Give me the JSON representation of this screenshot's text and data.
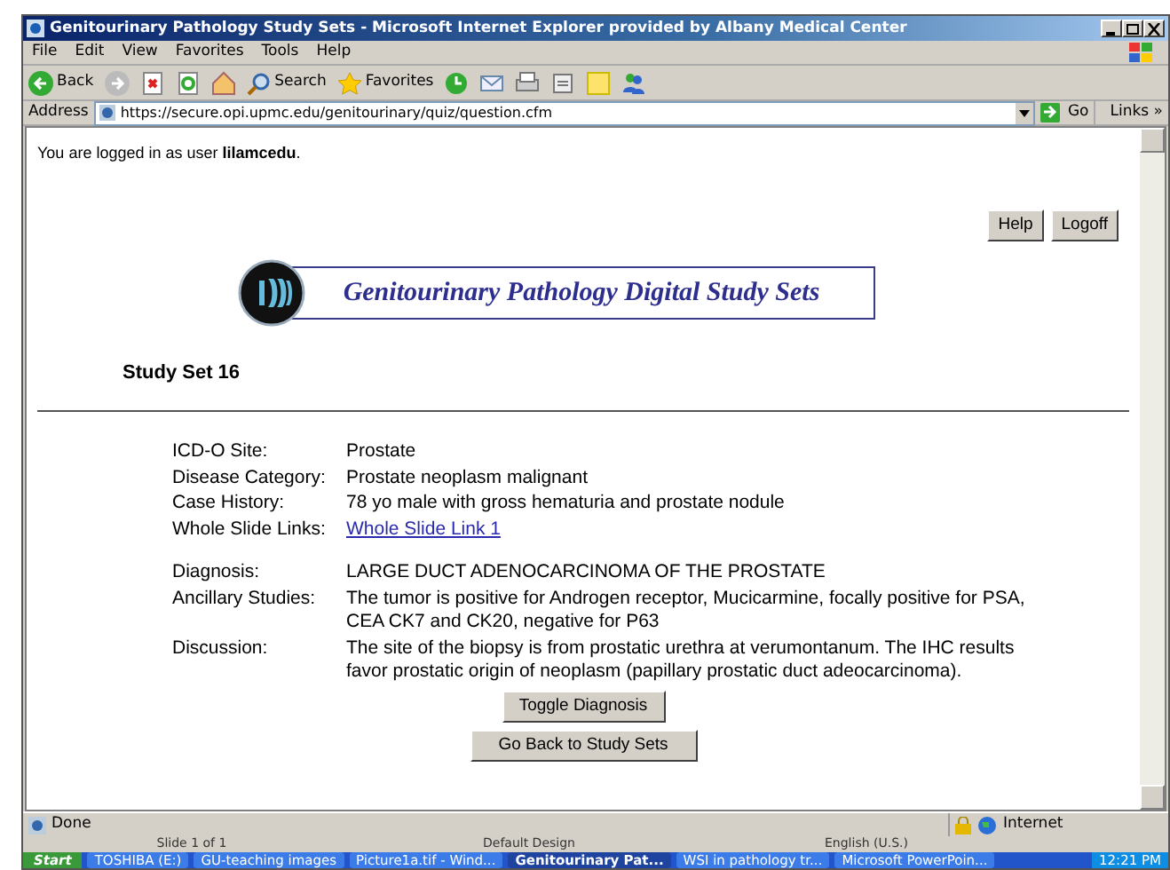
{
  "window": {
    "title": "Genitourinary Pathology Study Sets - Microsoft Internet Explorer provided by Albany Medical Center"
  },
  "menu": [
    "File",
    "Edit",
    "View",
    "Favorites",
    "Tools",
    "Help"
  ],
  "toolbar": [
    {
      "kind": "back",
      "label": "Back"
    },
    {
      "kind": "forward"
    },
    {
      "kind": "stop"
    },
    {
      "kind": "refresh"
    },
    {
      "kind": "home"
    },
    {
      "kind": "search",
      "label": "Search"
    },
    {
      "kind": "favorites",
      "label": "Favorites"
    },
    {
      "kind": "history"
    },
    {
      "kind": "mail"
    },
    {
      "kind": "print"
    },
    {
      "kind": "edit"
    },
    {
      "kind": "note"
    },
    {
      "kind": "messenger"
    }
  ],
  "address": {
    "label": "Address",
    "url": "https://secure.opi.upmc.edu/genitourinary/quiz/question.cfm",
    "go": "Go",
    "links": "Links »"
  },
  "page": {
    "login": "You are logged in as user **lilamcedu**.",
    "top_buttons": [
      "Help",
      "Logoff"
    ],
    "banner": "Genitourinary Pathology Digital Study Sets",
    "heading": "Study Set 16",
    "fields": [
      {
        "label": "ICD-O Site:",
        "value": "Prostate",
        "kind": "text"
      },
      {
        "label": "Disease Category:",
        "value": "Prostate neoplasm malignant",
        "kind": "text"
      },
      {
        "label": "Case History:",
        "value": "78 yo male with gross hematuria and prostate nodule",
        "kind": "text"
      },
      {
        "label": "Whole Slide Links:",
        "value": "Whole Slide Link 1",
        "kind": "link"
      }
    ],
    "diagnosis": [
      {
        "label": "Diagnosis:",
        "value": "LARGE DUCT ADENOCARCINOMA OF THE PROSTATE",
        "kind": "text"
      },
      {
        "label": "Ancillary Studies:",
        "value": "The tumor is positive for Androgen receptor, Mucicarmine, focally positive for PSA, CEA CK7 and CK20, negative for P63",
        "kind": "text"
      },
      {
        "label": "Discussion:",
        "value": "The site of the biopsy is from prostatic urethra at verumontanum. The IHC results favor prostatic origin of neoplasm (papillary prostatic duct adeocarcinoma).",
        "kind": "text"
      }
    ],
    "buttons": [
      "Toggle Diagnosis",
      "Go Back to Study Sets"
    ]
  },
  "status_bar": {
    "text": "Done",
    "zone": "Internet"
  },
  "behind": [
    "Slide 1 of 1",
    "Default Design",
    "English (U.S.)"
  ],
  "taskbar": {
    "start": "Start",
    "items": [
      {
        "label": "TOSHIBA (E:)",
        "selected": false
      },
      {
        "label": "GU-teaching images",
        "selected": false
      },
      {
        "label": "Picture1a.tif - Wind...",
        "selected": false
      },
      {
        "label": "Genitourinary Pat...",
        "selected": true
      },
      {
        "label": "WSI in pathology tr...",
        "selected": false
      },
      {
        "label": "Microsoft PowerPoin...",
        "selected": false
      }
    ],
    "clock": "12:21 PM"
  }
}
